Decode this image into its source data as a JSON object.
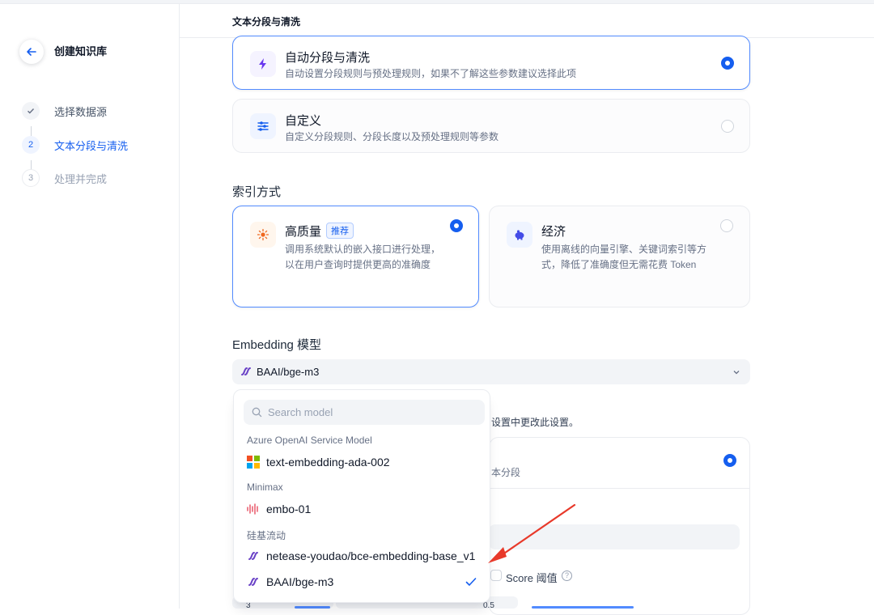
{
  "sidebar": {
    "title": "创建知识库",
    "steps": [
      {
        "num": "✓",
        "label": "选择数据源",
        "state": "done"
      },
      {
        "num": "2",
        "label": "文本分段与清洗",
        "state": "active"
      },
      {
        "num": "3",
        "label": "处理并完成",
        "state": "todo"
      }
    ]
  },
  "main": {
    "section_title": "文本分段与清洗",
    "segmentation": {
      "auto": {
        "title": "自动分段与清洗",
        "desc": "自动设置分段规则与预处理规则，如果不了解这些参数建议选择此项",
        "selected": true
      },
      "custom": {
        "title": "自定义",
        "desc": "自定义分段规则、分段长度以及预处理规则等参数",
        "selected": false
      }
    },
    "index_label": "索引方式",
    "index": {
      "high": {
        "title": "高质量",
        "badge": "推荐",
        "desc1": "调用系统默认的嵌入接口进行处理，",
        "desc2": "以在用户查询时提供更高的准确度",
        "selected": true
      },
      "eco": {
        "title": "经济",
        "desc1": "使用离线的向量引擎、关键词索引等方",
        "desc2": "式，降低了准确度但无需花费 Token",
        "selected": false
      }
    },
    "embedding_label": "Embedding 模型",
    "embedding_value": "BAAI/bge-m3",
    "hint_partial": "设置中更改此设置。",
    "retrieval_card_text": "本分段",
    "score_label": "Score 阈值",
    "bottom_values": {
      "left": "3",
      "right": "0.5"
    }
  },
  "dropdown": {
    "search_placeholder": "Search model",
    "groups": [
      {
        "name": "Azure OpenAI Service Model",
        "items": [
          {
            "name": "text-embedding-ada-002",
            "icon": "microsoft-icon"
          }
        ]
      },
      {
        "name": "Minimax",
        "items": [
          {
            "name": "embo-01",
            "icon": "minimax-icon"
          }
        ]
      },
      {
        "name": "硅基流动",
        "items": [
          {
            "name": "netease-youdao/bce-embedding-base_v1",
            "icon": "siliconflow-icon"
          },
          {
            "name": "BAAI/bge-m3",
            "icon": "siliconflow-icon",
            "selected": true
          }
        ]
      }
    ]
  },
  "colors": {
    "accent": "#155eef",
    "arrow": "#e8392a"
  }
}
